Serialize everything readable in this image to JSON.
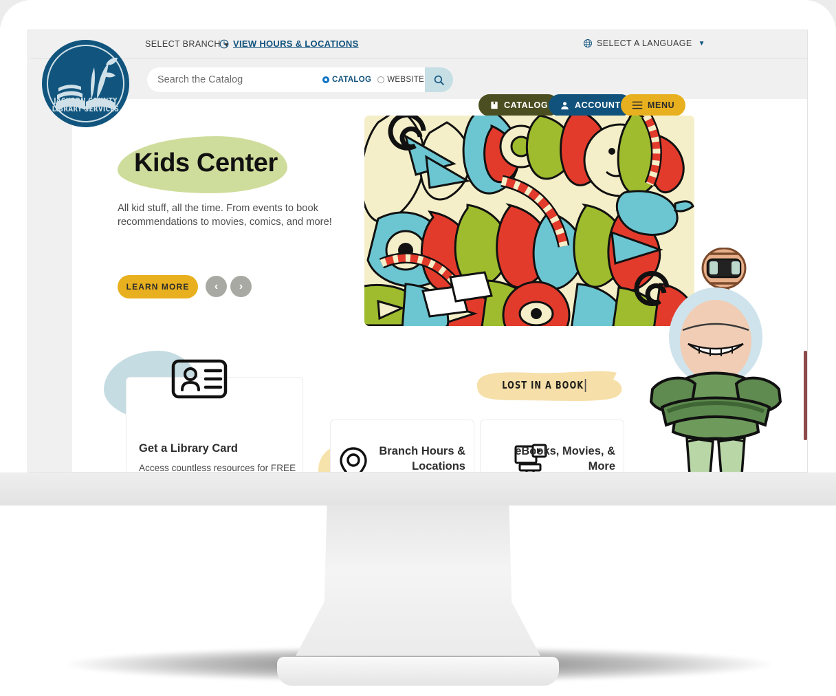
{
  "utility_bar": {
    "select_branch": "SELECT BRANCH",
    "view_hours": "VIEW HOURS & LOCATIONS",
    "select_language": "SELECT A LANGUAGE"
  },
  "search": {
    "placeholder": "Search the Catalog",
    "value": "",
    "radio_catalog": "CATALOG",
    "radio_website": "WEBSITE",
    "selected": "CATALOG"
  },
  "header_buttons": {
    "catalog": "CATALOG",
    "account": "ACCOUNT",
    "menu": "MENU"
  },
  "logo": {
    "line1": "JACKSON COUNTY",
    "line2": "LIBRARY SERVICES"
  },
  "hero": {
    "title": "Kids Center",
    "subtitle": "All kid stuff, all the time. From events to book recommendations to movies, comics, and more!",
    "cta": "LEARN MORE",
    "prev": "‹",
    "next": "›"
  },
  "banner": {
    "lost_in_a_book": "LOST IN A BOOK"
  },
  "cards": [
    {
      "title": "Get a Library Card",
      "desc": "Access countless resources for FREE",
      "icon": "id-card-icon"
    },
    {
      "title": "Branch Hours & Locations",
      "icon": "map-pin-icon"
    },
    {
      "title": "eBooks, Movies, & More",
      "icon": "screen-play-icon"
    }
  ],
  "colors": {
    "brand_blue": "#11527d",
    "brand_yellow": "#e8b01e",
    "brand_olive": "#4b4e20",
    "hero_blob_green": "#cfdd9c",
    "blob_blue": "#c5dce2",
    "blob_yellow": "#f6e3ab",
    "side_tab_maroon": "#8f4a4a"
  }
}
